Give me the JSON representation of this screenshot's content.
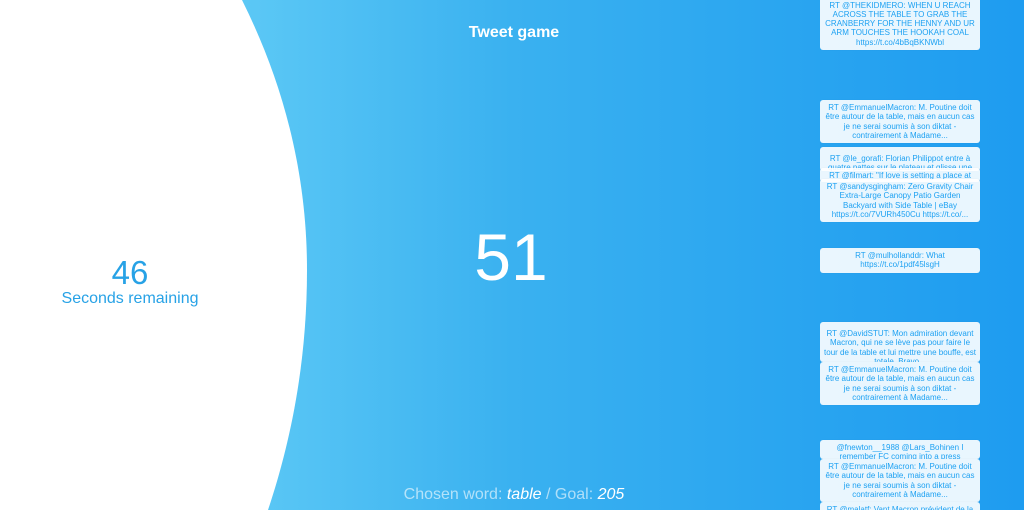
{
  "title": "Tweet game",
  "timer": {
    "value": "46",
    "label": "Seconds remaining"
  },
  "score": "51",
  "footer": {
    "chosen_word_label": "Chosen word:",
    "chosen_word": "table",
    "separator": "/",
    "goal_label": "Goal:",
    "goal_value": "205"
  },
  "tweets": [
    {
      "text": "RT @THEKIDMERO: WHEN U REACH ACROSS THE TABLE TO GRAB THE CRANBERRY FOR THE HENNY AND UR ARM TOUCHES THE HOOKAH COAL https://t.co/4bBqBKNWbl"
    },
    {
      "text": "RT @EmmanuelMacron: M. Poutine doit être autour de la table, mais en aucun cas je ne serai soumis à son diktat - contrairement à Madame..."
    },
    {
      "text": "RT @le_gorafi: Florian Philippot entre à quatre pattes sur le plateau et glisse une"
    },
    {
      "text": "RT @filmart: \"If love is setting a place at"
    },
    {
      "text": "RT @sandysgingham: Zero Gravity Chair Extra-Large Canopy Patio Garden Backyard with Side Table | eBay https://t.co/7VURh450Cu https://t.co/..."
    },
    {
      "text": "RT @mulhollanddr: What https://t.co/1pdf45lsgH"
    },
    {
      "text": "RT @DavidSTUT: Mon admiration devant Macron, qui ne se lève pas pour faire le tour de la table et lui mettre une bouffe, est totale. Bravo..."
    },
    {
      "text": "RT @EmmanuelMacron: M. Poutine doit être autour de la table, mais en aucun cas je ne serai soumis à son diktat - contrairement à Madame..."
    },
    {
      "text": "@fnewton__1988 @Lars_Bohinen I remember FC coming into a press"
    },
    {
      "text": "RT @EmmanuelMacron: M. Poutine doit être autour de la table, mais en aucun cas je ne serai soumis à son diktat - contrairement à Madame..."
    },
    {
      "text": "RT @malatf: Vant Macron prévident de la"
    }
  ],
  "colors": {
    "accent": "#1da1f2",
    "background_left": "#72d3f8",
    "background_right": "#1e9cf0",
    "panel": "#ffffff",
    "timer_text": "#27a2e6"
  }
}
